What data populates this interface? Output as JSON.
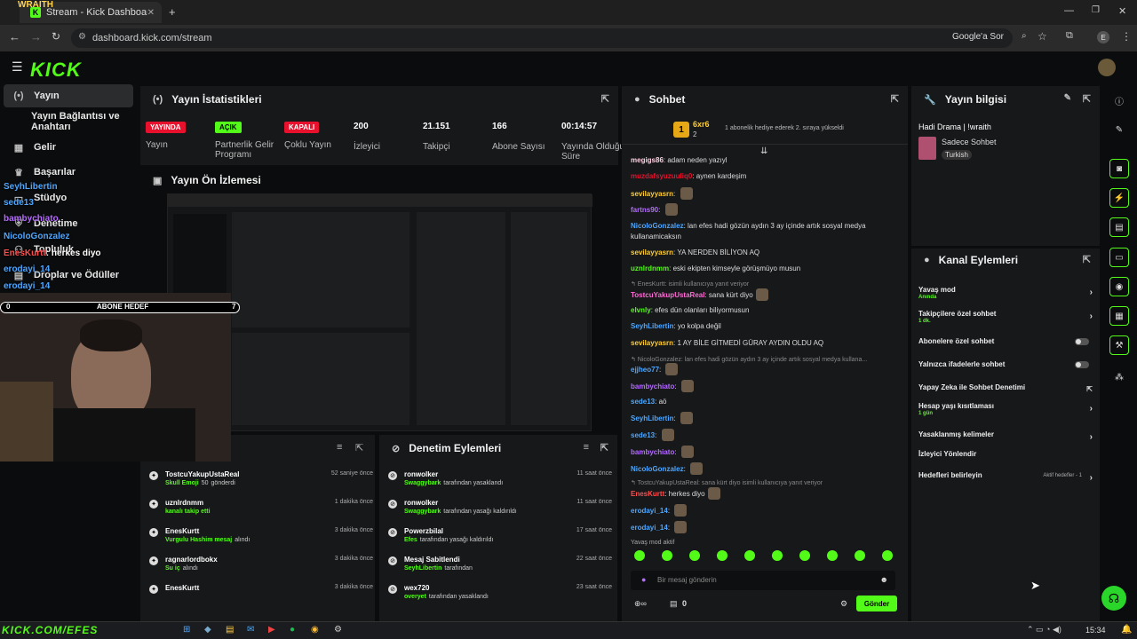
{
  "browser": {
    "tab_title": "Stream - Kick Dashboard",
    "url": "dashboard.kick.com/stream",
    "google_label": "Google'a Sor",
    "profile": "E"
  },
  "overlay": {
    "brand": "WRAITH",
    "goal_left": "0",
    "goal_label": "ABONE HEDEF",
    "goal_right": "7",
    "goal_progress": 0.0,
    "banner": "KICK.COM/EFES",
    "names": [
      {
        "n": "SeyhLibertin",
        "c": "#4da6ff"
      },
      {
        "n": "sede13",
        "c": "#4da6ff"
      },
      {
        "n": "bambychiato",
        "c": "#b46bff"
      },
      {
        "n": "NicoloGonzalez",
        "c": "#4da6ff"
      },
      {
        "n": "EnesKurtt",
        "c": "#ff4d4d",
        "t": ": herkes diyo"
      },
      {
        "n": "erodayi_14",
        "c": "#4da6ff"
      },
      {
        "n": "erodayi_14",
        "c": "#4da6ff"
      }
    ]
  },
  "sidebar": {
    "items": [
      {
        "label": "Yayın",
        "icon": "broadcast-icon",
        "active": true
      },
      {
        "label": "Yayın Bağlantısı ve Anahtarı",
        "icon": ""
      },
      {
        "label": "Gelir",
        "icon": "money-icon"
      },
      {
        "label": "Başarılar",
        "icon": "trophy-icon"
      },
      {
        "label": "Stüdyo",
        "icon": "studio-icon"
      },
      {
        "label": "Denetime",
        "icon": "shield-icon"
      },
      {
        "label": "Topluluk",
        "icon": "community-icon"
      },
      {
        "label": "Droplar ve Ödüller",
        "icon": "gift-icon"
      }
    ]
  },
  "stats": {
    "title": "Yayın İstatistikleri",
    "items": [
      {
        "badge": "YAYINDA",
        "badge_color": "#e8112d",
        "label": "Yayın"
      },
      {
        "badge": "AÇIK",
        "badge_color": "#53fc18",
        "label": "Partnerlik Gelir Programı"
      },
      {
        "badge": "KAPALI",
        "badge_color": "#e8112d",
        "label": "Çoklu Yayın"
      },
      {
        "value": "200",
        "label": "İzleyici"
      },
      {
        "value": "21.151",
        "label": "Takipçi"
      },
      {
        "value": "166",
        "label": "Abone Sayısı"
      },
      {
        "value": "00:14:57",
        "label": "Yayında Olduğu Süre"
      }
    ]
  },
  "preview": {
    "title": "Yayın Ön İzlemesi"
  },
  "activity": {
    "items": [
      {
        "name": "TostcuYakupUstaReal",
        "time": "52 saniye önce",
        "desc": "Skull Emoji",
        "desc2": "50",
        "desc3": "gönderdi"
      },
      {
        "name": "uznlrdnmm",
        "time": "1 dakika önce",
        "desc": "kanalı takip etti"
      },
      {
        "name": "EnesKurtt",
        "time": "3 dakika önce",
        "desc": "Vurgulu Hashim mesaj",
        "desc2": "alındı"
      },
      {
        "name": "ragnarlordbokx",
        "time": "3 dakika önce",
        "desc": "Su iç",
        "desc2": "alındı"
      },
      {
        "name": "EnesKurtt",
        "time": "3 dakika önce",
        "desc": ""
      }
    ]
  },
  "moderation": {
    "title": "Denetim Eylemleri",
    "items": [
      {
        "name": "ronwolker",
        "time": "11 saat önce",
        "by": "Swaggybark",
        "desc": "tarafından yasaklandı"
      },
      {
        "name": "ronwolker",
        "time": "11 saat önce",
        "by": "Swaggybark",
        "desc": "tarafından yasağı kaldırıldı"
      },
      {
        "name": "Powerzbilal",
        "time": "17 saat önce",
        "by": "Efes",
        "desc": "tarafından yasağı kaldırıldı"
      },
      {
        "name": "Mesaj Sabitlendi",
        "time": "22 saat önce",
        "by": "SeyhLibertin",
        "desc": "tarafından"
      },
      {
        "name": "wex720",
        "time": "23 saat önce",
        "by": "overyet",
        "desc": "tarafından yasaklandı"
      }
    ]
  },
  "chat": {
    "title": "Sohbet",
    "gift_user": "6xr6",
    "gift_count": "2",
    "gift_text": "1 abonelik hediye ederek 2. sıraya yükseldi",
    "messages": [
      {
        "u": "megigs86",
        "c": "#ffd0e0",
        "t": "adam neden yazıyl"
      },
      {
        "u": "muzdafsyuzuuliq0",
        "c": "#e8112d",
        "t": "aynen kardeşim"
      },
      {
        "u": "sevilayyasrn",
        "c": "#ffcc33",
        "t": "",
        "em": true
      },
      {
        "u": "fartns90",
        "c": "#b46bff",
        "t": "",
        "em": true
      },
      {
        "u": "NicoloGonzalez",
        "c": "#4da6ff",
        "t": "lan efes hadi gözün aydın 3 ay içinde artık sosyal medya"
      },
      {
        "u": "",
        "c": "",
        "t": "kullanamicaksın"
      },
      {
        "u": "sevilayyasrn",
        "c": "#ffcc33",
        "t": "YA NERDEN BİLİYON AQ"
      },
      {
        "u": "uznlrdnmm",
        "c": "#53fc18",
        "t": "eski ekipten kimseyle görüşmüyo musun"
      },
      {
        "u": "",
        "c": "",
        "t": "↰ EnesKurtt:  isimli kullanıcıya yanıt veriyor",
        "reply": true
      },
      {
        "u": "TostcuYakupUstaReal",
        "c": "#ff6bd5",
        "t": "sana kürt diyo",
        "em": true
      },
      {
        "u": "elvnly",
        "c": "#53fc18",
        "t": "efes dün olanları biliyormusun"
      },
      {
        "u": "SeyhLibertin",
        "c": "#4da6ff",
        "t": "yo kolpa değil"
      },
      {
        "u": "sevilayyasrn",
        "c": "#ffcc33",
        "t": "1 AY BİLE GİTMEDİ GÜRAY AYDIN OLDU AQ"
      },
      {
        "u": "",
        "c": "",
        "t": "↰ NicoloGonzalez: lan efes hadi gözün aydın 3 ay içinde artık sosyal medya kullana...",
        "reply": true
      },
      {
        "u": "ejjheo77",
        "c": "#4da6ff",
        "t": "",
        "em": true
      },
      {
        "u": "bambychiato",
        "c": "#b46bff",
        "t": "",
        "em": true
      },
      {
        "u": "sede13",
        "c": "#4da6ff",
        "t": "aö"
      },
      {
        "u": "SeyhLibertin",
        "c": "#4da6ff",
        "t": "",
        "em": true
      },
      {
        "u": "sede13",
        "c": "#4da6ff",
        "t": "",
        "em": true
      },
      {
        "u": "bambychiato",
        "c": "#b46bff",
        "t": "",
        "em": true
      },
      {
        "u": "NicoloGonzalez",
        "c": "#4da6ff",
        "t": "",
        "em": true
      },
      {
        "u": "",
        "c": "",
        "t": "↰ TostcuYakupUstaReal: sana kürt diyo  isimli kullanıcıya yanıt veriyor",
        "reply": true
      },
      {
        "u": "EnesKurtt",
        "c": "#ff4d4d",
        "t": "herkes diyo",
        "em": true
      },
      {
        "u": "erodayi_14",
        "c": "#4da6ff",
        "t": "",
        "em": true
      },
      {
        "u": "erodayi_14",
        "c": "#4da6ff",
        "t": "",
        "em": true
      }
    ],
    "slow": "Yavaş mod aktif",
    "placeholder": "Bir mesaj gönderin",
    "send": "Gönder",
    "count": "0"
  },
  "info": {
    "title": "Yayın bilgisi",
    "stream_title": "Hadi Drama | !wraith",
    "category": "Sadece Sohbet",
    "tag": "Turkish"
  },
  "actions": {
    "title": "Kanal Eylemleri",
    "items": [
      {
        "label": "Yavaş mod",
        "sub": "Anında",
        "type": "arrow"
      },
      {
        "label": "Takipçilere özel sohbet",
        "sub": "1 dk.",
        "type": "arrow"
      },
      {
        "label": "Abonelere özel sohbet",
        "type": "toggle"
      },
      {
        "label": "Yalnızca ifadelerle sohbet",
        "type": "toggle"
      },
      {
        "label": "Yapay Zeka ile Sohbet Denetimi",
        "type": "ext"
      },
      {
        "label": "Hesap yaşı kısıtlaması",
        "sub": "1 gün",
        "type": "arrow"
      },
      {
        "label": "Yasaklanmış kelimeler",
        "type": "arrow"
      },
      {
        "label": "İzleyici Yönlendir",
        "type": "none"
      },
      {
        "label": "Hedefleri belirleyin",
        "type": "arrow",
        "extra": "Aktif hedefler - 1"
      }
    ]
  },
  "taskbar": {
    "time": "15:34"
  }
}
